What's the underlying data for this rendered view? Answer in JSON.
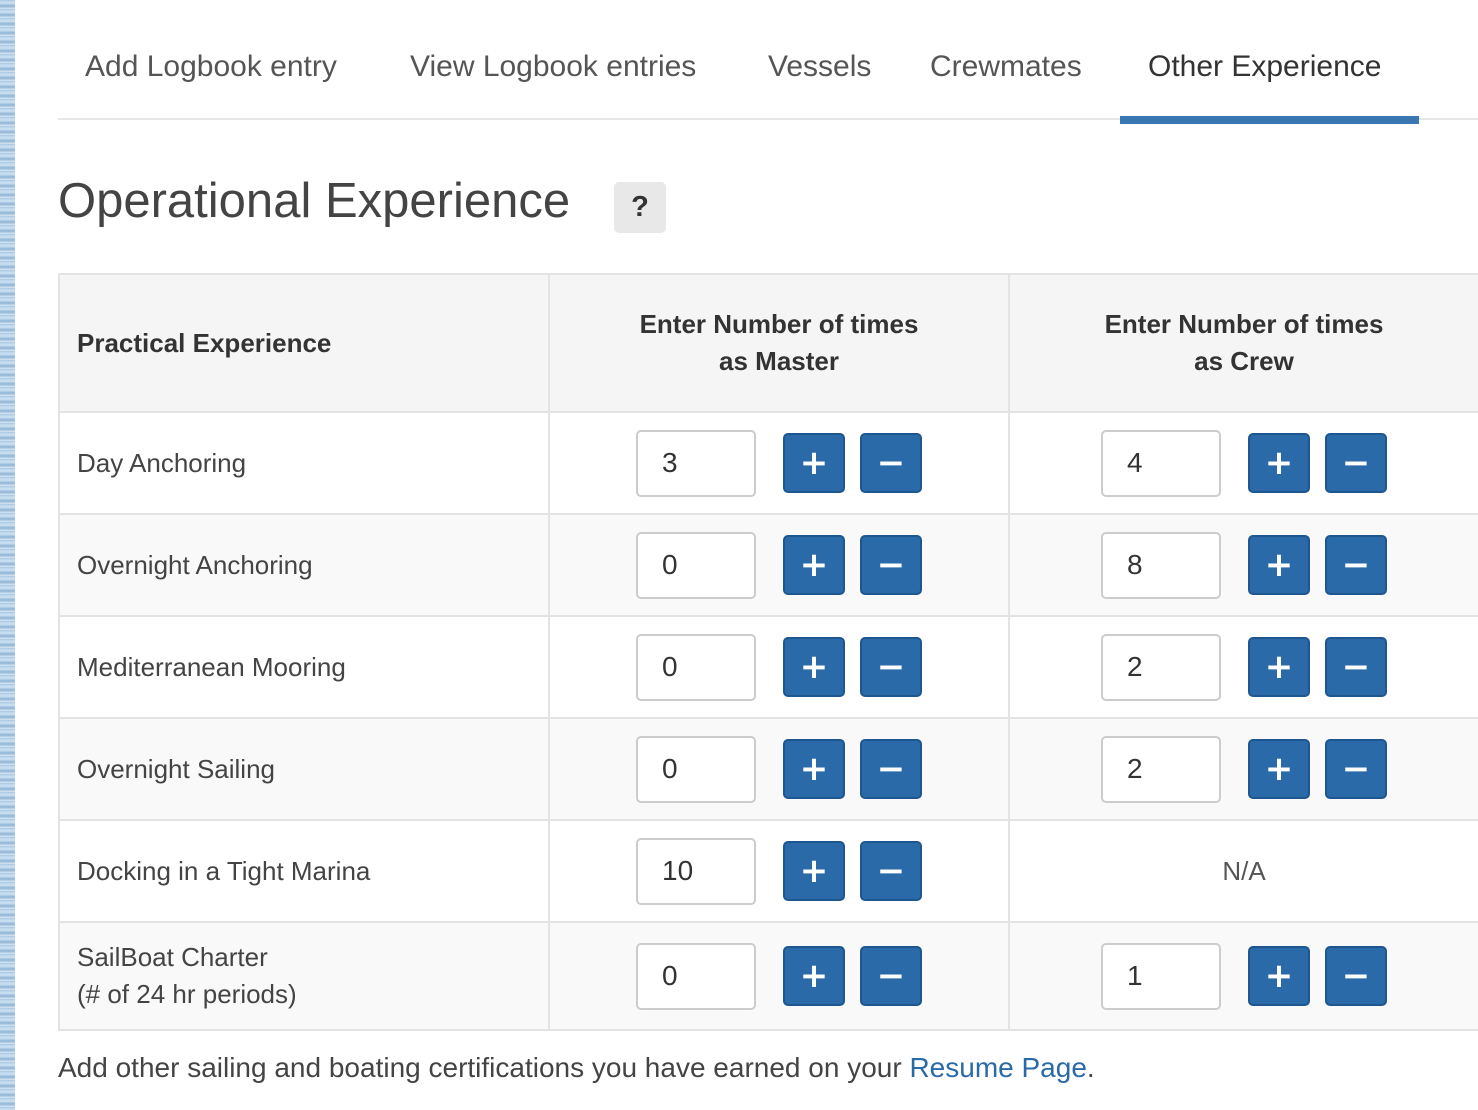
{
  "tabs": [
    {
      "label": "Add Logbook entry"
    },
    {
      "label": "View Logbook entries"
    },
    {
      "label": "Vessels"
    },
    {
      "label": "Crewmates"
    },
    {
      "label": "Other Experience"
    }
  ],
  "active_tab": "Other Experience",
  "page_title": "Operational Experience",
  "help_label": "?",
  "table": {
    "headers": {
      "label": "Practical Experience",
      "master_line1": "Enter Number of times",
      "master_line2": "as Master",
      "crew_line1": "Enter Number of times",
      "crew_line2": "as Crew"
    },
    "rows": [
      {
        "label": "Day Anchoring",
        "label_line2": "",
        "master": "3",
        "crew": "4"
      },
      {
        "label": "Overnight Anchoring",
        "label_line2": "",
        "master": "0",
        "crew": "8"
      },
      {
        "label": "Mediterranean Mooring",
        "label_line2": "",
        "master": "0",
        "crew": "2"
      },
      {
        "label": "Overnight Sailing",
        "label_line2": "",
        "master": "0",
        "crew": "2"
      },
      {
        "label": "Docking in a Tight Marina",
        "label_line2": "",
        "master": "10",
        "crew": "N/A"
      },
      {
        "label": "SailBoat Charter",
        "label_line2": "(# of 24 hr periods)",
        "master": "0",
        "crew": "1"
      }
    ],
    "plus_label": "+",
    "minus_label": "−"
  },
  "footer": {
    "text": "Add other sailing and boating certifications you have earned on your ",
    "link": "Resume Page",
    "suffix": "."
  },
  "colors": {
    "accent": "#3b78b3",
    "button": "#2b6aa8",
    "link": "#2b6aa8"
  }
}
